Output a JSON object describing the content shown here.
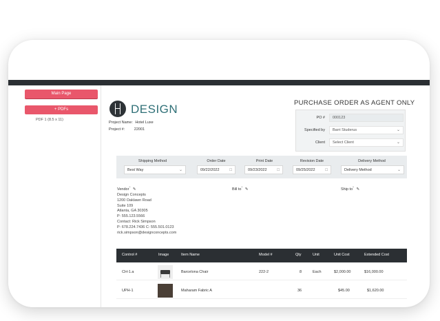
{
  "sidebar": {
    "main_page": "Main Page",
    "pdfs_label": "+ PDFs",
    "pdf_item": "PDF 1 (8.5 x 11)"
  },
  "logo": {
    "text": "DESIGN"
  },
  "project": {
    "name_label": "Project Name:",
    "name_value": "Hotel Luxe",
    "num_label": "Project #:",
    "num_value": "22001"
  },
  "po": {
    "title": "PURCHASE ORDER AS AGENT ONLY",
    "po_label": "PO #",
    "po_value": "000123",
    "spec_label": "Specified by",
    "spec_value": "Barri Studerus",
    "client_label": "Client",
    "client_value": "Select Client"
  },
  "methods": [
    {
      "header": "Shipping Method",
      "value": "Best Way",
      "icon": "chevron-down-icon"
    },
    {
      "header": "Order Date",
      "value": "09/22/2022",
      "icon": "calendar-icon"
    },
    {
      "header": "Print Date",
      "value": "09/23/2022",
      "icon": "calendar-icon"
    },
    {
      "header": "Revision Date",
      "value": "09/25/2022",
      "icon": "calendar-icon"
    },
    {
      "header": "Delivery Method",
      "value": "Delivery Method",
      "icon": "chevron-down-icon"
    }
  ],
  "address": {
    "vendor_label": "Vendor",
    "billto_label": "Bill to",
    "shipto_label": "Ship to",
    "vendor_lines": [
      "Design Concepts",
      "1200 Oaklawn Road",
      "Suite 109",
      "Atlanta, GA 30305",
      "P: 555.123.5566",
      "Contact: Rick Simpson",
      "P: 678.224.7436 C: 555.501.0123",
      "rick.simpson@designconcepts.com"
    ]
  },
  "table": {
    "headers": [
      "Control #",
      "Image",
      "Item Name",
      "Model #",
      "Qty",
      "Unit",
      "Unit Cost",
      "Extended Cost"
    ],
    "rows": [
      [
        "CH-1.a",
        "",
        "Barcelona Chair",
        "222-2",
        "8",
        "Each",
        "$2,000.00",
        "$16,000.00"
      ],
      [
        "UPH-1",
        "",
        "Maharam Fabric A",
        "",
        "36",
        "",
        "$45.00",
        "$1,620.00"
      ]
    ]
  },
  "colors": {
    "accent": "#e9576b",
    "dark": "#2b2f33",
    "brand": "#2e6f76"
  }
}
